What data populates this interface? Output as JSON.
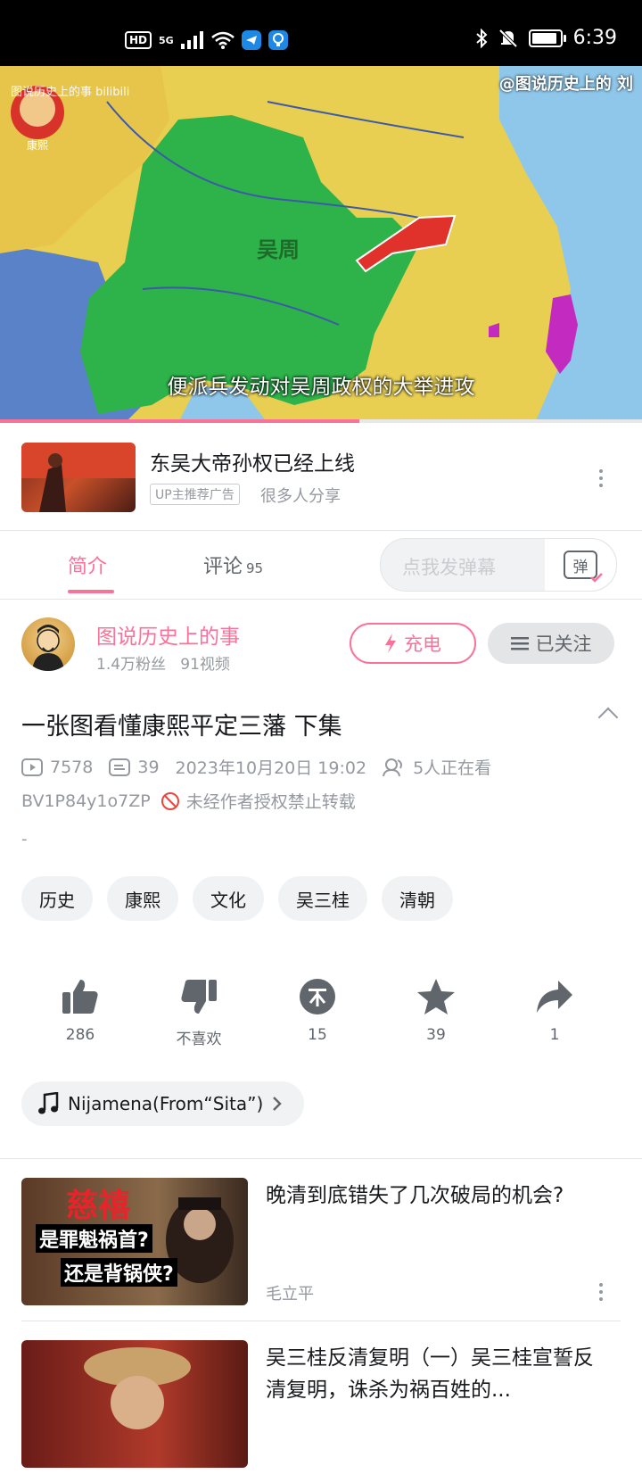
{
  "status_bar": {
    "hd": "HD",
    "network": "5G",
    "time": "6:39"
  },
  "video": {
    "watermark_left": "图说历史上的事 bilibili",
    "watermark_right": "@图说历史上的",
    "overlay_char": "刘",
    "emperor_label": "康熙",
    "region_label": "吴周",
    "subtitle": "便派兵发动对吴周政权的大举进攻",
    "progress_fraction": 0.56,
    "accent_color": "#fb7299"
  },
  "ad": {
    "title": "东吴大帝孙权已经上线",
    "tag": "UP主推荐广告",
    "share_text": "很多人分享"
  },
  "tabs": {
    "intro": "简介",
    "comments": "评论",
    "comments_count": "95",
    "danmu_placeholder": "点我发弹幕",
    "danmu_icon_char": "弹"
  },
  "author": {
    "name": "图说历史上的事",
    "fans": "1.4万粉丝",
    "videos": "91视频",
    "charge_label": "充电",
    "follow_label": "已关注"
  },
  "video_info": {
    "title": "一张图看懂康熙平定三藩 下集",
    "plays": "7578",
    "danmaku": "39",
    "date": "2023年10月20日 19:02",
    "watching": "5人正在看",
    "bvid": "BV1P84y1o7ZP",
    "copyright": "未经作者授权禁止转载",
    "description": "-"
  },
  "tags": [
    "历史",
    "康熙",
    "文化",
    "吴三桂",
    "清朝"
  ],
  "actions": {
    "like": "286",
    "dislike": "不喜欢",
    "coin": "15",
    "favorite": "39",
    "share": "1"
  },
  "music": {
    "title": "Nijamena(From“Sita”)"
  },
  "recommendations": [
    {
      "title": "晚清到底错失了几次破局的机会?",
      "uploader": "毛立平",
      "thumb_text_1": "慈禧",
      "thumb_text_2": "是罪魁祸首?",
      "thumb_text_3": "还是背锅侠?"
    },
    {
      "title": "吴三桂反清复明（一）吴三桂宣誓反清复明，诛杀为祸百姓的...",
      "uploader": ""
    }
  ]
}
